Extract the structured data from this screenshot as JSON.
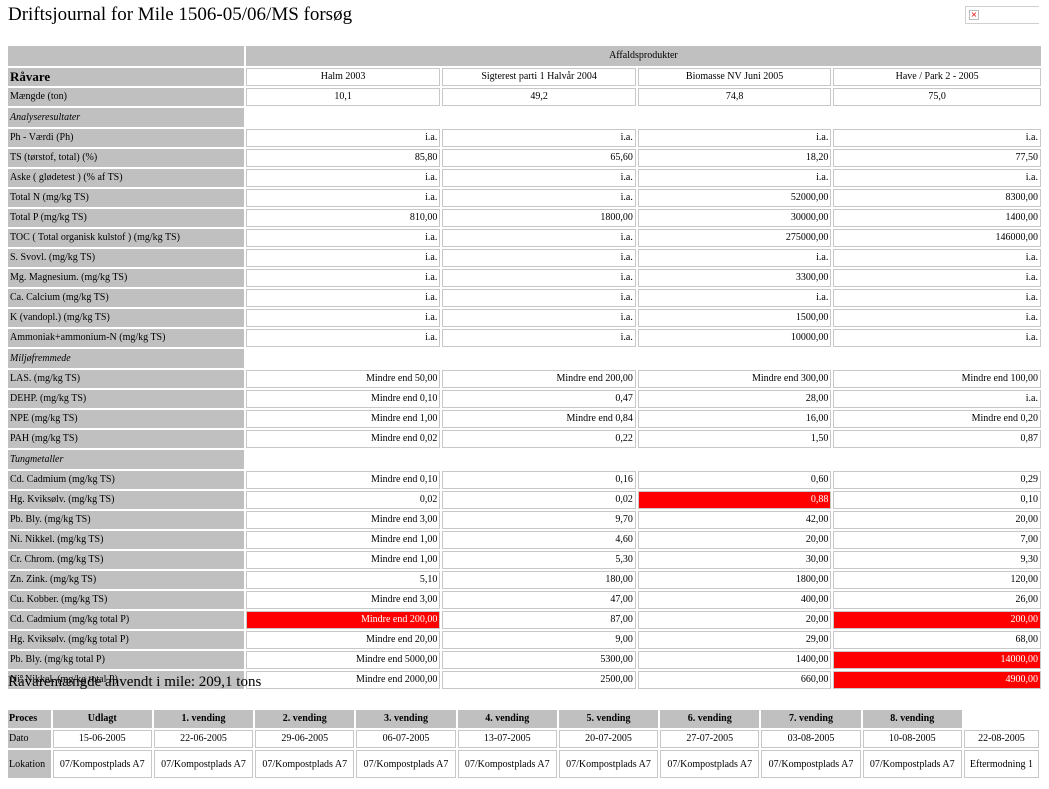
{
  "title": "Driftsjournal for Mile 1506-05/06/MS forsøg",
  "broken_image_icon": "broken-image-icon",
  "main": {
    "group_header": "Affaldsprodukter",
    "raw_label": "Råvare",
    "columns": [
      "Halm 2003",
      "Sigterest parti 1 Halvår 2004",
      "Biomasse NV Juni 2005",
      "Have / Park 2 - 2005"
    ],
    "amount": {
      "label": "Mængde (ton)",
      "values": [
        "10,1",
        "49,2",
        "74,8",
        "75,0"
      ]
    },
    "sections": [
      {
        "title": "Analyseresultater",
        "rows": [
          {
            "label": "Ph - Værdi (Ph)",
            "values": [
              "i.a.",
              "i.a.",
              "i.a.",
              "i.a."
            ]
          },
          {
            "label": "TS (tørstof, total) (%)",
            "values": [
              "85,80",
              "65,60",
              "18,20",
              "77,50"
            ]
          },
          {
            "label": "Aske ( glødetest ) (% af TS)",
            "values": [
              "i.a.",
              "i.a.",
              "i.a.",
              "i.a."
            ]
          },
          {
            "label": "Total N (mg/kg TS)",
            "values": [
              "i.a.",
              "i.a.",
              "52000,00",
              "8300,00"
            ]
          },
          {
            "label": "Total P (mg/kg TS)",
            "values": [
              "810,00",
              "1800,00",
              "30000,00",
              "1400,00"
            ]
          },
          {
            "label": "TOC ( Total organisk kulstof ) (mg/kg TS)",
            "values": [
              "i.a.",
              "i.a.",
              "275000,00",
              "146000,00"
            ]
          },
          {
            "label": "S. Svovl. (mg/kg TS)",
            "values": [
              "i.a.",
              "i.a.",
              "i.a.",
              "i.a."
            ]
          },
          {
            "label": "Mg. Magnesium. (mg/kg TS)",
            "values": [
              "i.a.",
              "i.a.",
              "3300,00",
              "i.a."
            ]
          },
          {
            "label": "Ca. Calcium (mg/kg TS)",
            "values": [
              "i.a.",
              "i.a.",
              "i.a.",
              "i.a."
            ]
          },
          {
            "label": "K (vandopl.) (mg/kg TS)",
            "values": [
              "i.a.",
              "i.a.",
              "1500,00",
              "i.a."
            ]
          },
          {
            "label": "Ammoniak+ammonium-N (mg/kg TS)",
            "values": [
              "i.a.",
              "i.a.",
              "10000,00",
              "i.a."
            ]
          }
        ]
      },
      {
        "title": "Miljøfremmede",
        "rows": [
          {
            "label": "LAS. (mg/kg TS)",
            "values": [
              "Mindre end 50,00",
              "Mindre end 200,00",
              "Mindre end 300,00",
              "Mindre end 100,00"
            ]
          },
          {
            "label": "DEHP. (mg/kg TS)",
            "values": [
              "Mindre end 0,10",
              "0,47",
              "28,00",
              "i.a."
            ]
          },
          {
            "label": "NPE (mg/kg TS)",
            "values": [
              "Mindre end 1,00",
              "Mindre end 0,84",
              "16,00",
              "Mindre end 0,20"
            ]
          },
          {
            "label": "PAH (mg/kg TS)",
            "values": [
              "Mindre end 0,02",
              "0,22",
              "1,50",
              "0,87"
            ]
          }
        ]
      },
      {
        "title": "Tungmetaller",
        "rows": [
          {
            "label": "Cd. Cadmium (mg/kg TS)",
            "values": [
              "Mindre end 0,10",
              "0,16",
              "0,60",
              "0,29"
            ]
          },
          {
            "label": "Hg. Kviksølv. (mg/kg TS)",
            "values": [
              "0,02",
              "0,02",
              "0,88",
              "0,10"
            ],
            "flags": [
              false,
              false,
              true,
              false
            ]
          },
          {
            "label": "Pb. Bly. (mg/kg TS)",
            "values": [
              "Mindre end 3,00",
              "9,70",
              "42,00",
              "20,00"
            ]
          },
          {
            "label": "Ni. Nikkel. (mg/kg TS)",
            "values": [
              "Mindre end 1,00",
              "4,60",
              "20,00",
              "7,00"
            ]
          },
          {
            "label": "Cr. Chrom. (mg/kg TS)",
            "values": [
              "Mindre end 1,00",
              "5,30",
              "30,00",
              "9,30"
            ]
          },
          {
            "label": "Zn. Zink. (mg/kg TS)",
            "values": [
              "5,10",
              "180,00",
              "1800,00",
              "120,00"
            ]
          },
          {
            "label": "Cu. Kobber. (mg/kg TS)",
            "values": [
              "Mindre end 3,00",
              "47,00",
              "400,00",
              "26,00"
            ]
          },
          {
            "label": "Cd. Cadmium (mg/kg total P)",
            "values": [
              "Mindre end 200,00",
              "87,00",
              "20,00",
              "200,00"
            ],
            "flags": [
              true,
              false,
              false,
              true
            ]
          },
          {
            "label": "Hg. Kviksølv. (mg/kg total P)",
            "values": [
              "Mindre end 20,00",
              "9,00",
              "29,00",
              "68,00"
            ]
          },
          {
            "label": "Pb. Bly. (mg/kg total P)",
            "values": [
              "Mindre end 5000,00",
              "5300,00",
              "1400,00",
              "14000,00"
            ],
            "flags": [
              false,
              false,
              false,
              true
            ]
          },
          {
            "label": "Ni. Nikkel. (mg/kg total P)",
            "values": [
              "Mindre end 2000,00",
              "2500,00",
              "660,00",
              "4900,00"
            ],
            "flags": [
              false,
              false,
              false,
              true
            ]
          }
        ]
      }
    ]
  },
  "summary": "Råvaremængde anvendt i mile: 209,1 tons",
  "process": {
    "labels": {
      "process": "Proces",
      "date": "Dato",
      "location": "Lokation"
    },
    "headers": [
      "Udlagt",
      "1. vending",
      "2. vending",
      "3. vending",
      "4. vending",
      "5. vending",
      "6. vending",
      "7. vending",
      "8. vending",
      ""
    ],
    "dates": [
      "15-06-2005",
      "22-06-2005",
      "29-06-2005",
      "06-07-2005",
      "13-07-2005",
      "20-07-2005",
      "27-07-2005",
      "03-08-2005",
      "10-08-2005",
      "22-08-2005"
    ],
    "locations": [
      "07/Kompostplads A7",
      "07/Kompostplads A7",
      "07/Kompostplads A7",
      "07/Kompostplads A7",
      "07/Kompostplads A7",
      "07/Kompostplads A7",
      "07/Kompostplads A7",
      "07/Kompostplads A7",
      "07/Kompostplads A7",
      "Eftermodning 1"
    ]
  },
  "colors": {
    "header_grey": "#c0c0c0",
    "flag_red": "#ff0000"
  }
}
